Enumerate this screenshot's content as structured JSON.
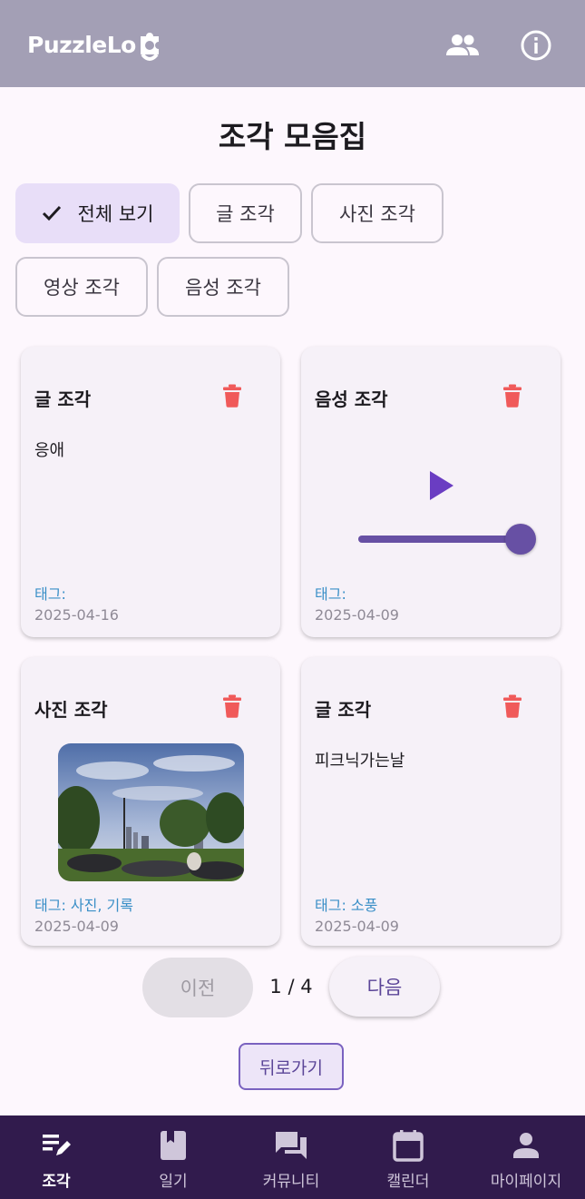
{
  "header": {
    "logo_text": "PuzzleLog",
    "logo_prefix": "Puzzle",
    "logo_suffix": "Lo",
    "icons": [
      "group-icon",
      "info-icon"
    ]
  },
  "page": {
    "title": "조각 모음집"
  },
  "filters": [
    {
      "label": "전체 보기",
      "selected": true
    },
    {
      "label": "글 조각",
      "selected": false
    },
    {
      "label": "사진 조각",
      "selected": false
    },
    {
      "label": "영상 조각",
      "selected": false
    },
    {
      "label": "음성 조각",
      "selected": false
    }
  ],
  "cards": [
    {
      "type": "글 조각",
      "body": "응애",
      "tag": "태그:",
      "date": "2025-04-16"
    },
    {
      "type": "음성 조각",
      "tag": "태그:",
      "date": "2025-04-09",
      "progress": 1.0
    },
    {
      "type": "사진 조각",
      "tag": "태그: 사진, 기록",
      "date": "2025-04-09"
    },
    {
      "type": "글 조각",
      "body": "피크닉가는날",
      "tag": "태그: 소풍",
      "date": "2025-04-09"
    }
  ],
  "pagination": {
    "prev": "이전",
    "info": "1 / 4",
    "next": "다음"
  },
  "back": "뒤로가기",
  "nav": [
    {
      "label": "조각",
      "icon": "edit-list-icon",
      "active": true
    },
    {
      "label": "일기",
      "icon": "book-icon",
      "active": false
    },
    {
      "label": "커뮤니티",
      "icon": "forum-icon",
      "active": false
    },
    {
      "label": "캘린더",
      "icon": "calendar-icon",
      "active": false
    },
    {
      "label": "마이페이지",
      "icon": "person-icon",
      "active": false
    }
  ],
  "colors": {
    "topbar": "#a39fb5",
    "accent": "#6750a4",
    "trash": "#f05a5a",
    "tag": "#3a8fc7",
    "nav_bg": "#311b4d"
  }
}
